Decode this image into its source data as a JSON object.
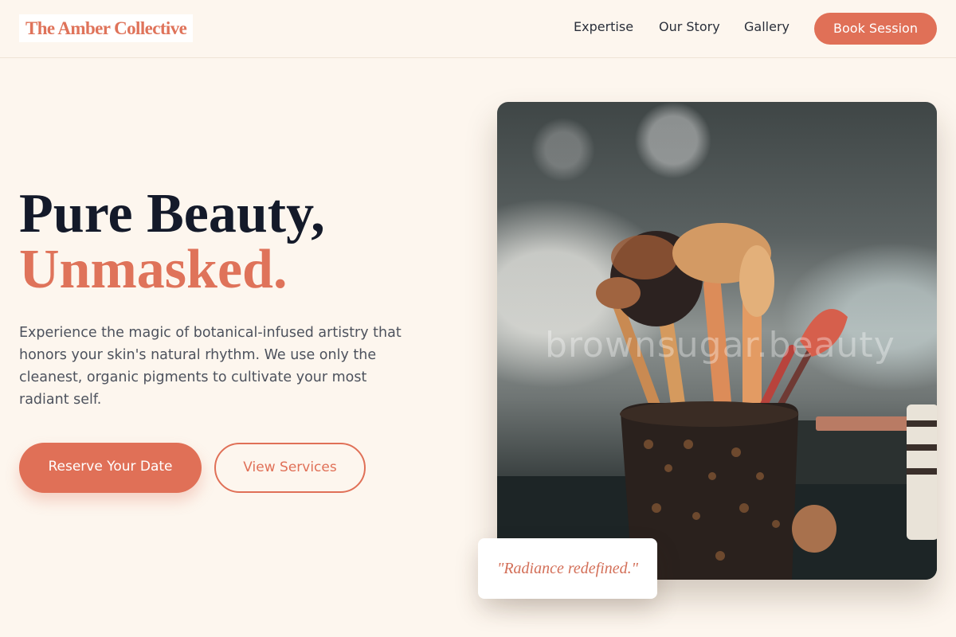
{
  "header": {
    "logo": "The Amber Collective",
    "nav": [
      "Expertise",
      "Our Story",
      "Gallery"
    ],
    "cta": "Book Session"
  },
  "hero": {
    "title_line1": "Pure Beauty,",
    "title_line2": "Unmasked.",
    "description": "Experience the magic of botanical-infused artistry that honors your skin's natural rhythm. We use only the cleanest, organic pigments to cultivate your most radiant self.",
    "primary_button": "Reserve Your Date",
    "secondary_button": "View Services"
  },
  "photo": {
    "watermark": "brownsugar.beauty"
  },
  "quote": "\"Radiance redefined.\"",
  "colors": {
    "accent": "#e07057",
    "background": "#fdf6ee",
    "heading": "#141a2a"
  }
}
